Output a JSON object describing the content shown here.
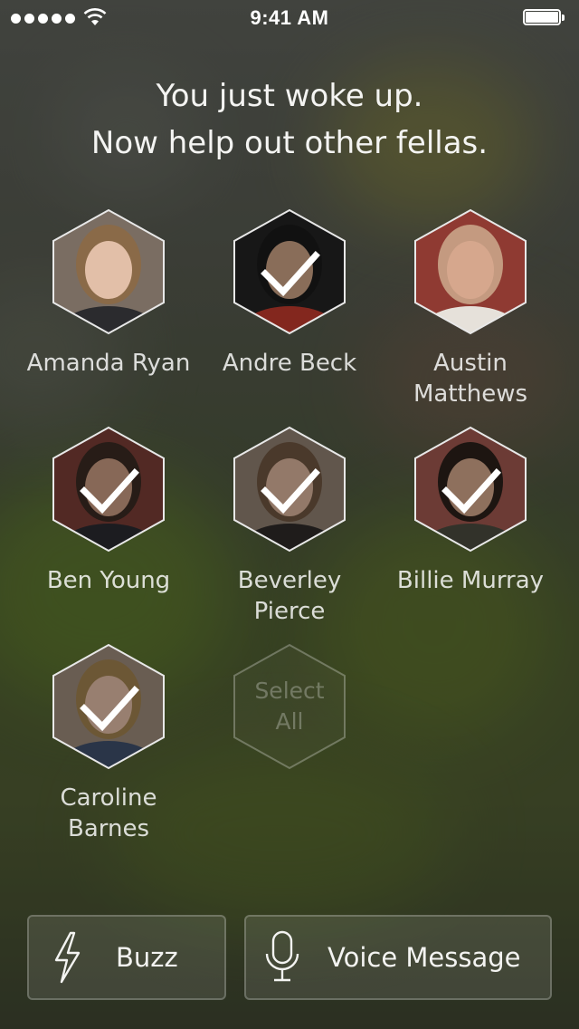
{
  "status_bar": {
    "time": "9:41 AM",
    "signal_icon": "signal-dots-icon",
    "wifi_icon": "wifi-icon",
    "battery_icon": "battery-icon"
  },
  "headline": {
    "line1": "You just woke up.",
    "line2": "Now help out other fellas."
  },
  "contacts": [
    {
      "name_lines": [
        "Amanda Ryan",
        ""
      ],
      "selected": false
    },
    {
      "name_lines": [
        "Andre Beck",
        ""
      ],
      "selected": true
    },
    {
      "name_lines": [
        "Austin",
        "Matthews"
      ],
      "selected": false
    },
    {
      "name_lines": [
        "Ben Young",
        ""
      ],
      "selected": true
    },
    {
      "name_lines": [
        "Beverley",
        "Pierce"
      ],
      "selected": true
    },
    {
      "name_lines": [
        "Billie Murray",
        ""
      ],
      "selected": true
    },
    {
      "name_lines": [
        "Caroline",
        "Barnes"
      ],
      "selected": true
    }
  ],
  "select_all": {
    "line1": "Select",
    "line2": "All"
  },
  "actions": {
    "buzz": {
      "label": "Buzz",
      "icon": "lightning-bolt-icon"
    },
    "voice": {
      "label": "Voice Message",
      "icon": "microphone-icon"
    }
  },
  "colors": {
    "text": "#ffffff",
    "hex_border": "#e8e8e8"
  }
}
